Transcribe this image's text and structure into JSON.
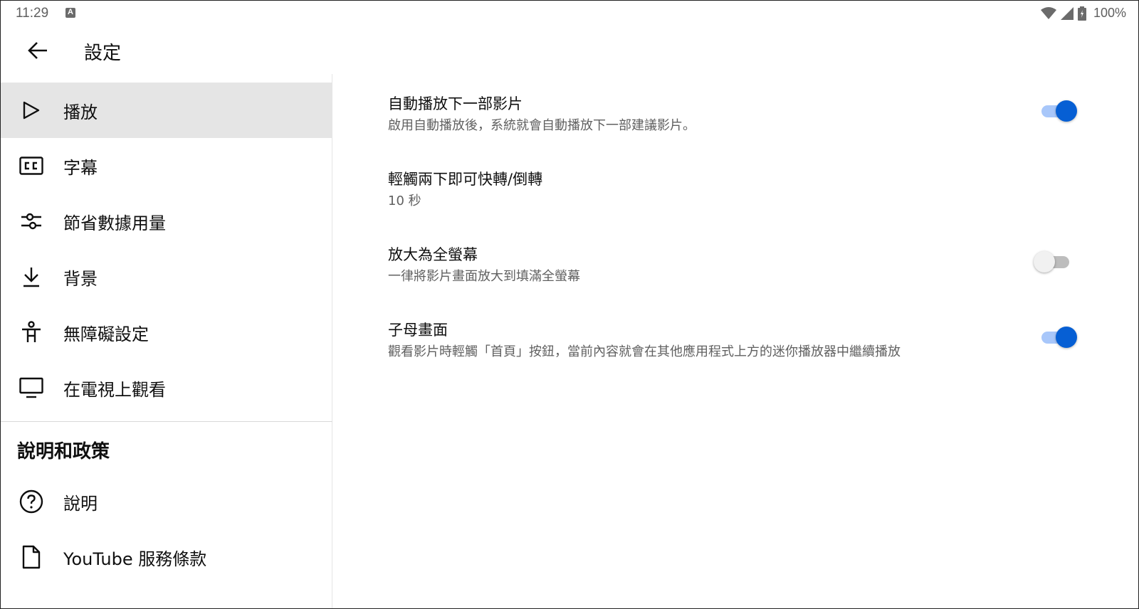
{
  "status_bar": {
    "time": "11:29",
    "battery_text": "100%"
  },
  "app_bar": {
    "title": "設定"
  },
  "sidebar": {
    "items": [
      {
        "label": "播放",
        "icon": "play-icon",
        "selected": true
      },
      {
        "label": "字幕",
        "icon": "closed-captions-icon",
        "selected": false
      },
      {
        "label": "節省數據用量",
        "icon": "tune-icon",
        "selected": false
      },
      {
        "label": "背景",
        "icon": "download-icon",
        "selected": false
      },
      {
        "label": "無障礙設定",
        "icon": "accessibility-icon",
        "selected": false
      },
      {
        "label": "在電視上觀看",
        "icon": "tv-icon",
        "selected": false
      }
    ],
    "section_header": "說明和政策",
    "help_items": [
      {
        "label": "說明",
        "icon": "help-icon"
      },
      {
        "label": "YouTube 服務條款",
        "icon": "document-icon"
      }
    ]
  },
  "settings": [
    {
      "title": "自動播放下一部影片",
      "subtitle": "啟用自動播放後，系統就會自動播放下一部建議影片。",
      "toggle": "on"
    },
    {
      "title": "輕觸兩下即可快轉/倒轉",
      "subtitle": "10 秒",
      "toggle": null
    },
    {
      "title": "放大為全螢幕",
      "subtitle": "一律將影片畫面放大到填滿全螢幕",
      "toggle": "off"
    },
    {
      "title": "子母畫面",
      "subtitle": "觀看影片時輕觸「首頁」按鈕，當前內容就會在其他應用程式上方的迷你播放器中繼續播放",
      "toggle": "on"
    }
  ],
  "colors": {
    "accent": "#065fd4",
    "accent_track": "#a8c7fa",
    "selected_bg": "#e5e5e5",
    "secondary_text": "#606060"
  }
}
